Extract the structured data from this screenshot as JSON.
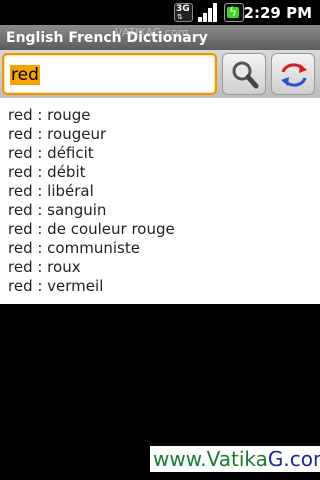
{
  "status_bar": {
    "network_label": "3G",
    "time": "2:29 PM",
    "battery_color": "#3bd61f"
  },
  "app": {
    "title": "English French Dictionary",
    "watermark_top": "VATIKAG.com"
  },
  "search": {
    "value": "red",
    "search_icon": "magnifier-icon",
    "swap_icon": "swap-direction-icon",
    "accent_color": "#f29600"
  },
  "results": [
    "red : rouge",
    "red : rougeur",
    "red : déficit",
    "red : débit",
    "red : libéral",
    "red : sanguin",
    "red : de couleur rouge",
    "red : communiste",
    "red : roux",
    "red : vermeil"
  ],
  "footer": {
    "logo_part1": "www.Vatika",
    "logo_part2": "G.com"
  }
}
